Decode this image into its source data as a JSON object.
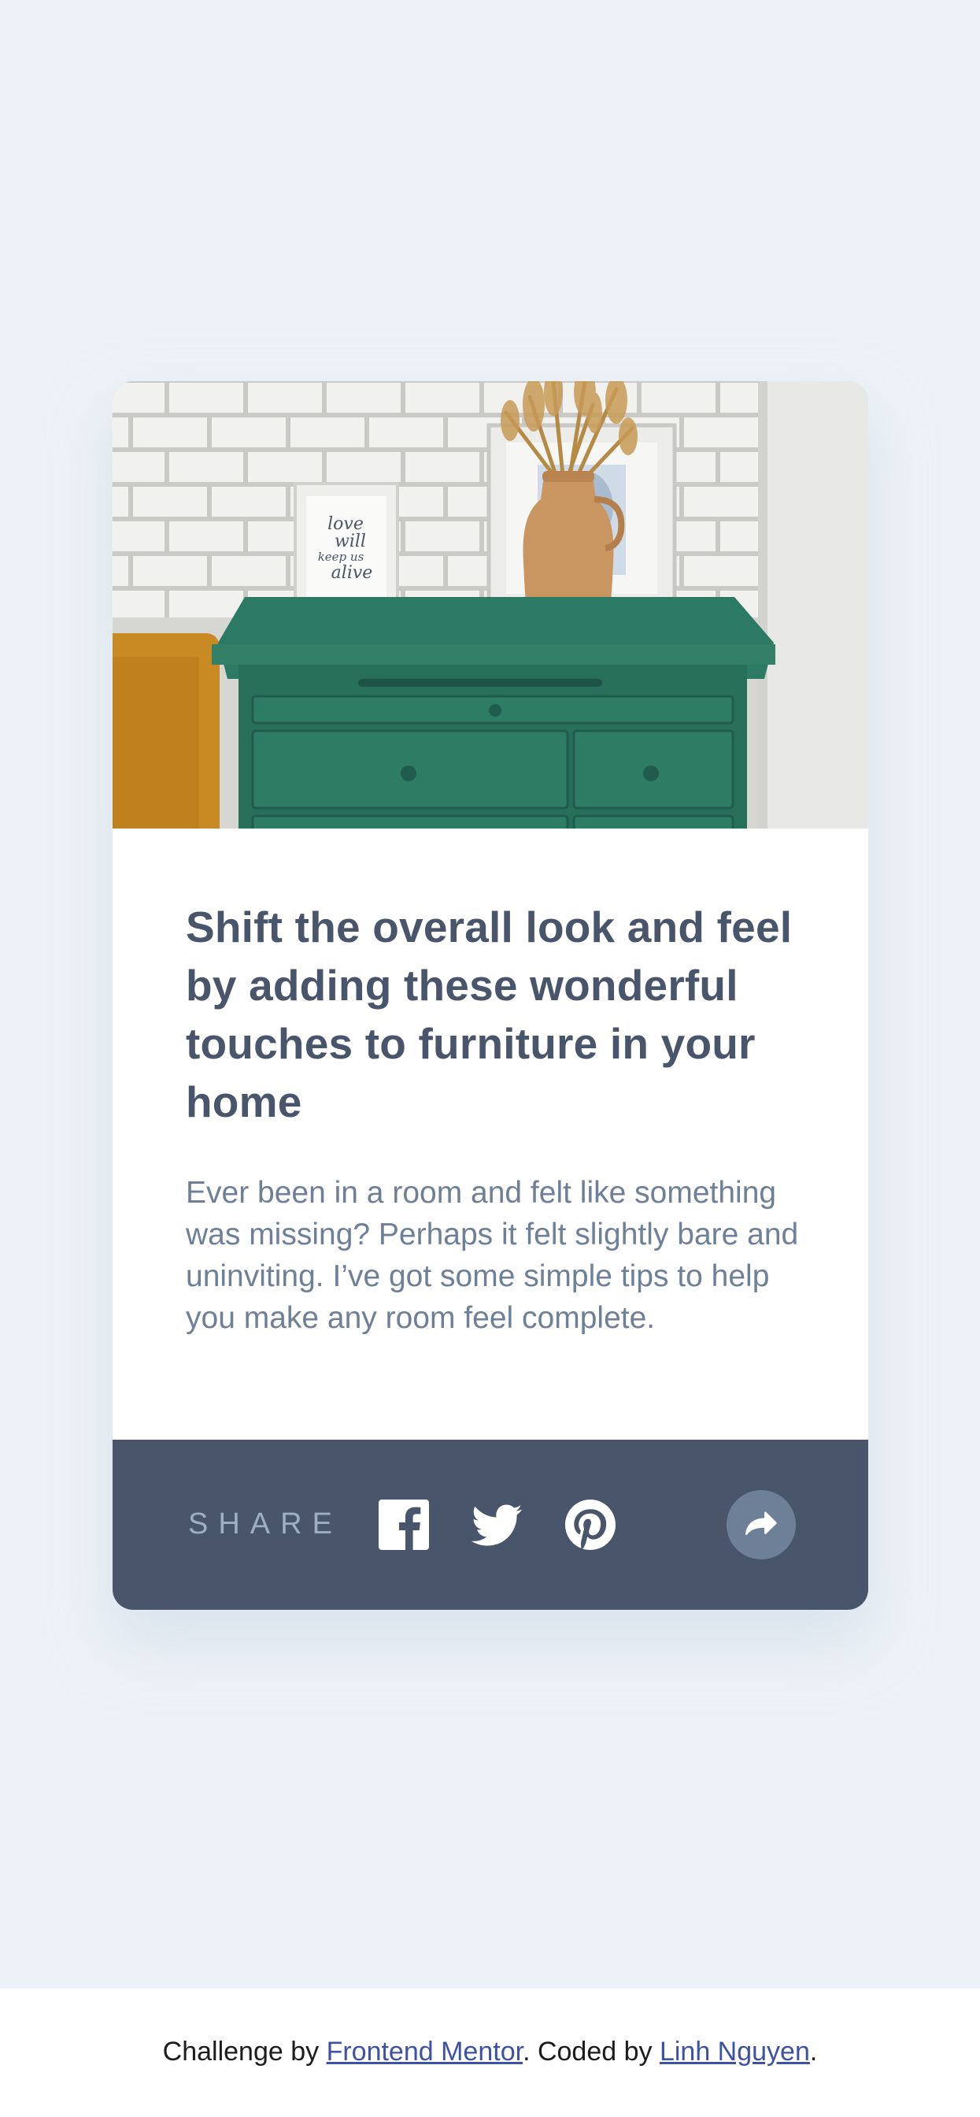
{
  "hero": {
    "frame_text_lines": [
      "love",
      "will",
      "keep us",
      "alive"
    ]
  },
  "article": {
    "title": "Shift the overall look and feel by adding these wonderful touches to furniture in your home",
    "description": "Ever been in a room and felt like something was missing? Perhaps it felt slightly bare and uninviting. I’ve got some simple tips to help you make any room feel complete."
  },
  "share": {
    "label": "SHARE",
    "icons": [
      "facebook-icon",
      "twitter-icon",
      "pinterest-icon",
      "share-arrow-icon"
    ]
  },
  "footer": {
    "prefix": "Challenge by ",
    "mentor_link": "Frontend Mentor",
    "middle": ". Coded by ",
    "author_link": "Linh Nguyen",
    "suffix": "."
  },
  "colors": {
    "page_background": "#ecf2f8",
    "title": "#48556a",
    "description": "#6e8098",
    "share_bar": "#48556a",
    "share_label": "#9eafc2",
    "share_button": "#6e8098",
    "link": "#3e52a3",
    "dresser": "#2c7a63"
  }
}
